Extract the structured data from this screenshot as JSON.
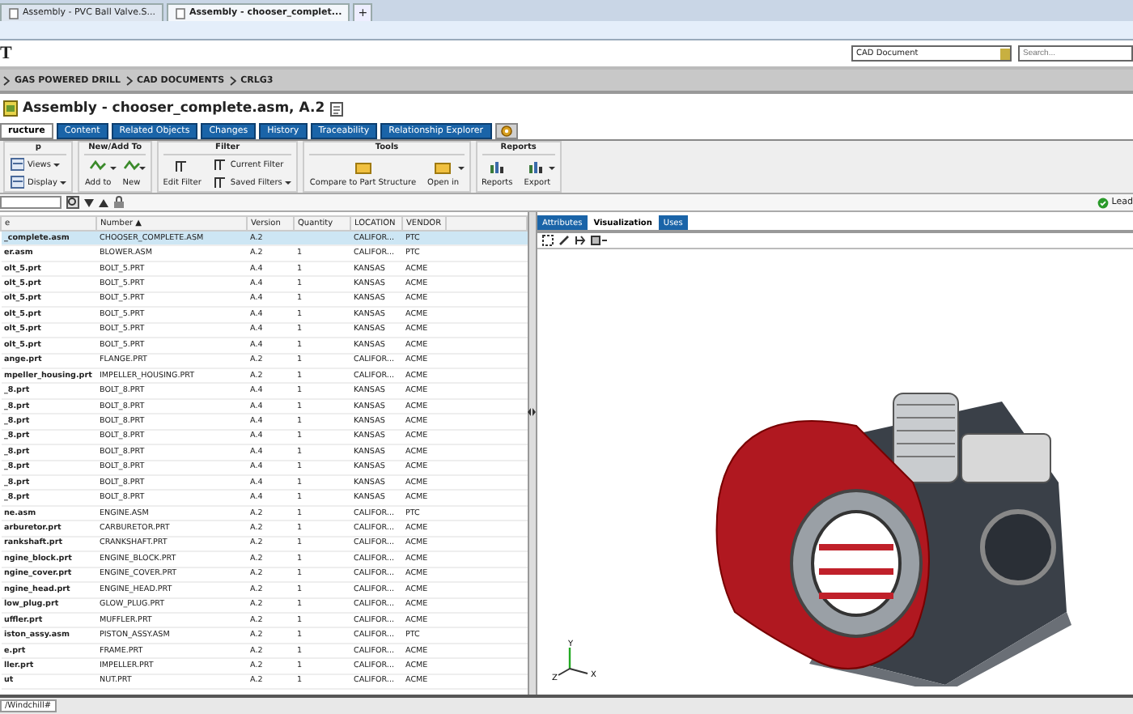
{
  "browser_tabs": [
    {
      "label": "Assembly - PVC Ball Valve.S...",
      "selected": false
    },
    {
      "label": "Assembly - chooser_complet...",
      "selected": true
    }
  ],
  "new_tab": "+",
  "logo": "T",
  "search": {
    "type_select": "CAD Document",
    "placeholder": "Search..."
  },
  "breadcrumb": [
    "GAS POWERED DRILL",
    "CAD DOCUMENTS",
    "CRLG3"
  ],
  "page_title": "Assembly - chooser_complete.asm, A.2",
  "tabs": [
    {
      "label": "ructure",
      "selected": true
    },
    {
      "label": "Content",
      "selected": false
    },
    {
      "label": "Related Objects",
      "selected": false
    },
    {
      "label": "Changes",
      "selected": false
    },
    {
      "label": "History",
      "selected": false
    },
    {
      "label": "Traceability",
      "selected": false
    },
    {
      "label": "Relationship Explorer",
      "selected": false
    }
  ],
  "toolbar": [
    {
      "title": "p",
      "items": [
        {
          "label": "Views",
          "kind": "small",
          "dropdown": true
        },
        {
          "label": "Display",
          "kind": "small",
          "dropdown": true
        }
      ]
    },
    {
      "title": "New/Add To",
      "items": [
        {
          "label": "Add to",
          "kind": "large",
          "dropdown": true
        },
        {
          "label": "New",
          "kind": "large",
          "dropdown": true
        }
      ]
    },
    {
      "title": "Filter",
      "items": [
        {
          "label": "Edit Filter",
          "kind": "large",
          "dropdown": false
        },
        {
          "label": "Current Filter",
          "kind": "small",
          "dropdown": false
        },
        {
          "label": "Saved Filters",
          "kind": "small",
          "dropdown": true
        }
      ]
    },
    {
      "title": "Tools",
      "items": [
        {
          "label": "Compare to Part Structure",
          "kind": "large",
          "dropdown": false
        },
        {
          "label": "Open in",
          "kind": "large",
          "dropdown": true
        }
      ]
    },
    {
      "title": "Reports",
      "items": [
        {
          "label": "Reports",
          "kind": "large",
          "dropdown": false
        },
        {
          "label": "Export",
          "kind": "large",
          "dropdown": true
        }
      ]
    }
  ],
  "filter_status": "Lead",
  "table": {
    "columns": [
      "e",
      "Number ▲",
      "Version",
      "Quantity",
      "LOCATION",
      "VENDOR"
    ],
    "rows": [
      {
        "cells": [
          "_complete.asm",
          "CHOOSER_COMPLETE.ASM",
          "A.2",
          "",
          "CALIFOR...",
          "PTC"
        ],
        "selected": true
      },
      {
        "cells": [
          "er.asm",
          "BLOWER.ASM",
          "A.2",
          "1",
          "CALIFOR...",
          "PTC"
        ],
        "selected": false
      },
      {
        "cells": [
          "olt_5.prt",
          "BOLT_5.PRT",
          "A.4",
          "1",
          "KANSAS",
          "ACME"
        ],
        "selected": false
      },
      {
        "cells": [
          "olt_5.prt",
          "BOLT_5.PRT",
          "A.4",
          "1",
          "KANSAS",
          "ACME"
        ],
        "selected": false
      },
      {
        "cells": [
          "olt_5.prt",
          "BOLT_5.PRT",
          "A.4",
          "1",
          "KANSAS",
          "ACME"
        ],
        "selected": false
      },
      {
        "cells": [
          "olt_5.prt",
          "BOLT_5.PRT",
          "A.4",
          "1",
          "KANSAS",
          "ACME"
        ],
        "selected": false
      },
      {
        "cells": [
          "olt_5.prt",
          "BOLT_5.PRT",
          "A.4",
          "1",
          "KANSAS",
          "ACME"
        ],
        "selected": false
      },
      {
        "cells": [
          "olt_5.prt",
          "BOLT_5.PRT",
          "A.4",
          "1",
          "KANSAS",
          "ACME"
        ],
        "selected": false
      },
      {
        "cells": [
          "ange.prt",
          "FLANGE.PRT",
          "A.2",
          "1",
          "CALIFOR...",
          "ACME"
        ],
        "selected": false
      },
      {
        "cells": [
          "mpeller_housing.prt",
          "IMPELLER_HOUSING.PRT",
          "A.2",
          "1",
          "CALIFOR...",
          "ACME"
        ],
        "selected": false
      },
      {
        "cells": [
          "_8.prt",
          "BOLT_8.PRT",
          "A.4",
          "1",
          "KANSAS",
          "ACME"
        ],
        "selected": false
      },
      {
        "cells": [
          "_8.prt",
          "BOLT_8.PRT",
          "A.4",
          "1",
          "KANSAS",
          "ACME"
        ],
        "selected": false
      },
      {
        "cells": [
          "_8.prt",
          "BOLT_8.PRT",
          "A.4",
          "1",
          "KANSAS",
          "ACME"
        ],
        "selected": false
      },
      {
        "cells": [
          "_8.prt",
          "BOLT_8.PRT",
          "A.4",
          "1",
          "KANSAS",
          "ACME"
        ],
        "selected": false
      },
      {
        "cells": [
          "_8.prt",
          "BOLT_8.PRT",
          "A.4",
          "1",
          "KANSAS",
          "ACME"
        ],
        "selected": false
      },
      {
        "cells": [
          "_8.prt",
          "BOLT_8.PRT",
          "A.4",
          "1",
          "KANSAS",
          "ACME"
        ],
        "selected": false
      },
      {
        "cells": [
          "_8.prt",
          "BOLT_8.PRT",
          "A.4",
          "1",
          "KANSAS",
          "ACME"
        ],
        "selected": false
      },
      {
        "cells": [
          "_8.prt",
          "BOLT_8.PRT",
          "A.4",
          "1",
          "KANSAS",
          "ACME"
        ],
        "selected": false
      },
      {
        "cells": [
          "ne.asm",
          "ENGINE.ASM",
          "A.2",
          "1",
          "CALIFOR...",
          "PTC"
        ],
        "selected": false
      },
      {
        "cells": [
          "arburetor.prt",
          "CARBURETOR.PRT",
          "A.2",
          "1",
          "CALIFOR...",
          "ACME"
        ],
        "selected": false
      },
      {
        "cells": [
          "rankshaft.prt",
          "CRANKSHAFT.PRT",
          "A.2",
          "1",
          "CALIFOR...",
          "ACME"
        ],
        "selected": false
      },
      {
        "cells": [
          "ngine_block.prt",
          "ENGINE_BLOCK.PRT",
          "A.2",
          "1",
          "CALIFOR...",
          "ACME"
        ],
        "selected": false
      },
      {
        "cells": [
          "ngine_cover.prt",
          "ENGINE_COVER.PRT",
          "A.2",
          "1",
          "CALIFOR...",
          "ACME"
        ],
        "selected": false
      },
      {
        "cells": [
          "ngine_head.prt",
          "ENGINE_HEAD.PRT",
          "A.2",
          "1",
          "CALIFOR...",
          "ACME"
        ],
        "selected": false
      },
      {
        "cells": [
          "low_plug.prt",
          "GLOW_PLUG.PRT",
          "A.2",
          "1",
          "CALIFOR...",
          "ACME"
        ],
        "selected": false
      },
      {
        "cells": [
          "uffler.prt",
          "MUFFLER.PRT",
          "A.2",
          "1",
          "CALIFOR...",
          "ACME"
        ],
        "selected": false
      },
      {
        "cells": [
          "iston_assy.asm",
          "PISTON_ASSY.ASM",
          "A.2",
          "1",
          "CALIFOR...",
          "PTC"
        ],
        "selected": false
      },
      {
        "cells": [
          "e.prt",
          "FRAME.PRT",
          "A.2",
          "1",
          "CALIFOR...",
          "ACME"
        ],
        "selected": false
      },
      {
        "cells": [
          "ller.prt",
          "IMPELLER.PRT",
          "A.2",
          "1",
          "CALIFOR...",
          "ACME"
        ],
        "selected": false
      },
      {
        "cells": [
          "ut",
          "NUT.PRT",
          "A.2",
          "1",
          "CALIFOR...",
          "ACME"
        ],
        "selected": false
      }
    ]
  },
  "viewer": {
    "tabs": [
      {
        "label": "Attributes",
        "selected": false
      },
      {
        "label": "Visualization",
        "selected": true
      },
      {
        "label": "Uses",
        "selected": false
      }
    ],
    "axes": [
      "Y",
      "X",
      "Z"
    ]
  },
  "status_bar": "/Windchill#"
}
